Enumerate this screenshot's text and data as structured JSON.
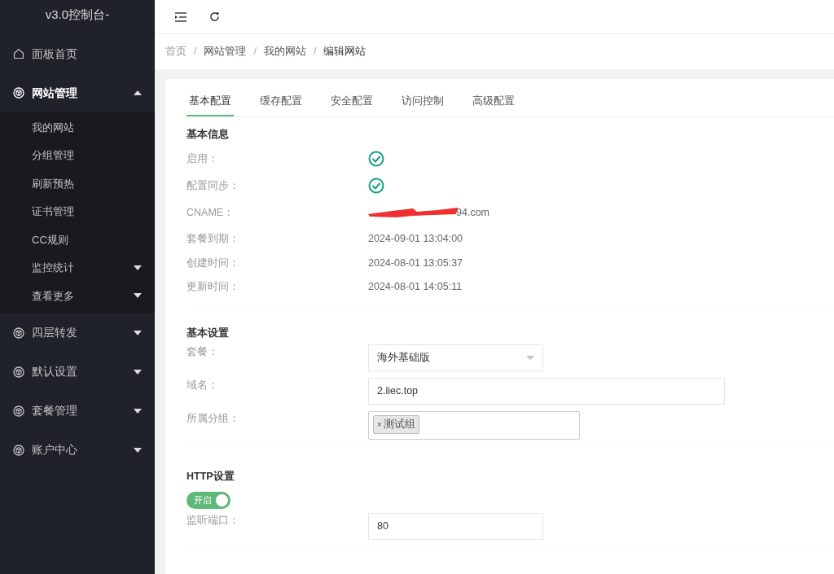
{
  "sidebar": {
    "title": "v3.0控制台-",
    "items": [
      {
        "label": "面板首页",
        "kind": "home"
      },
      {
        "label": "网站管理",
        "kind": "cube",
        "expanded": true,
        "children": [
          {
            "label": "我的网站"
          },
          {
            "label": "分组管理"
          },
          {
            "label": "刷新预热"
          },
          {
            "label": "证书管理"
          },
          {
            "label": "CC规则"
          },
          {
            "label": "监控统计",
            "expanded": false
          },
          {
            "label": "查看更多",
            "expanded": false
          }
        ]
      },
      {
        "label": "四层转发",
        "kind": "cube",
        "expanded": false
      },
      {
        "label": "默认设置",
        "kind": "cube",
        "expanded": false
      },
      {
        "label": "套餐管理",
        "kind": "cube",
        "expanded": false
      },
      {
        "label": "账户中心",
        "kind": "cube",
        "expanded": false
      }
    ]
  },
  "breadcrumb": [
    {
      "label": "首页"
    },
    {
      "separator": "/",
      "label": "网站管理"
    },
    {
      "separator": "/",
      "label": "我的网站"
    },
    {
      "separator": "/",
      "label": "编辑网站"
    }
  ],
  "tabs": [
    {
      "label": "基本配置",
      "selected": true
    },
    {
      "label": "缓存配置",
      "selected": false
    },
    {
      "label": "安全配置",
      "selected": false
    },
    {
      "label": "访问控制",
      "selected": false
    },
    {
      "label": "高级配置",
      "selected": false
    }
  ],
  "sections": [
    {
      "title": "基本信息",
      "rows": [
        {
          "label": "启用：",
          "kind": "check",
          "checked": true
        },
        {
          "label": "配置同步：",
          "kind": "check",
          "checked": true
        },
        {
          "label": "CNAME：",
          "kind": "text",
          "value": "94.com",
          "redacted": true
        },
        {
          "label": "套餐到期：",
          "kind": "text",
          "value": "2024-09-01 13:04:00"
        },
        {
          "label": "创建时间：",
          "kind": "text",
          "value": "2024-08-01 13:05:37"
        },
        {
          "label": "更新时间：",
          "kind": "text",
          "value": "2024-08-01 14:05:11"
        }
      ]
    },
    {
      "title": "基本设置",
      "rows": [
        {
          "label": "套餐：",
          "kind": "select",
          "value": "海外基础版"
        },
        {
          "label": "域名：",
          "kind": "input",
          "value": "2.liec.top"
        },
        {
          "label": "所属分组：",
          "kind": "tags",
          "tags": [
            {
              "remove": "×",
              "text": "测试组"
            }
          ]
        }
      ]
    },
    {
      "title": "HTTP设置",
      "rows": [
        {
          "kind": "switch",
          "on": true,
          "text": "开启"
        },
        {
          "label": "监听端口：",
          "kind": "port",
          "value": "80"
        }
      ]
    }
  ]
}
